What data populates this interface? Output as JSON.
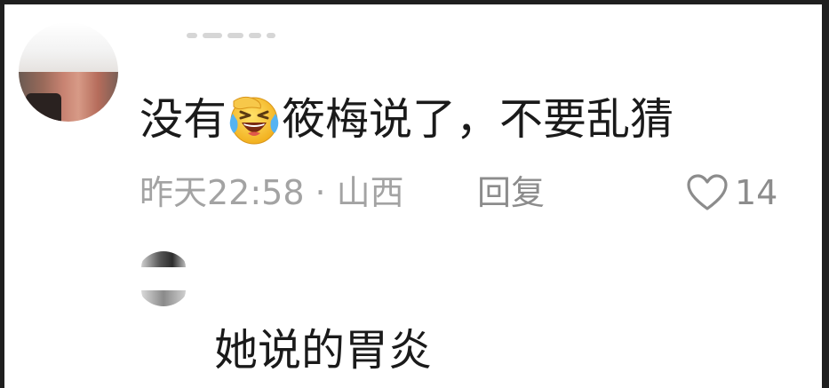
{
  "comment": {
    "text_before_emoji": "没有",
    "emoji": "crying-laughing-emoji",
    "text_after_emoji": "筱梅说了，不要乱猜",
    "timestamp": "昨天22:58",
    "separator": "·",
    "location": "山西",
    "reply_label": "回复",
    "like_icon": "heart-outline-icon",
    "like_count": "14"
  },
  "reply": {
    "text": "她说的胃炎"
  },
  "colors": {
    "text_primary": "#1a1a1a",
    "text_meta": "#a3a3a3",
    "text_action": "#8c8c8c",
    "frame_border": "#1f1f1f"
  }
}
